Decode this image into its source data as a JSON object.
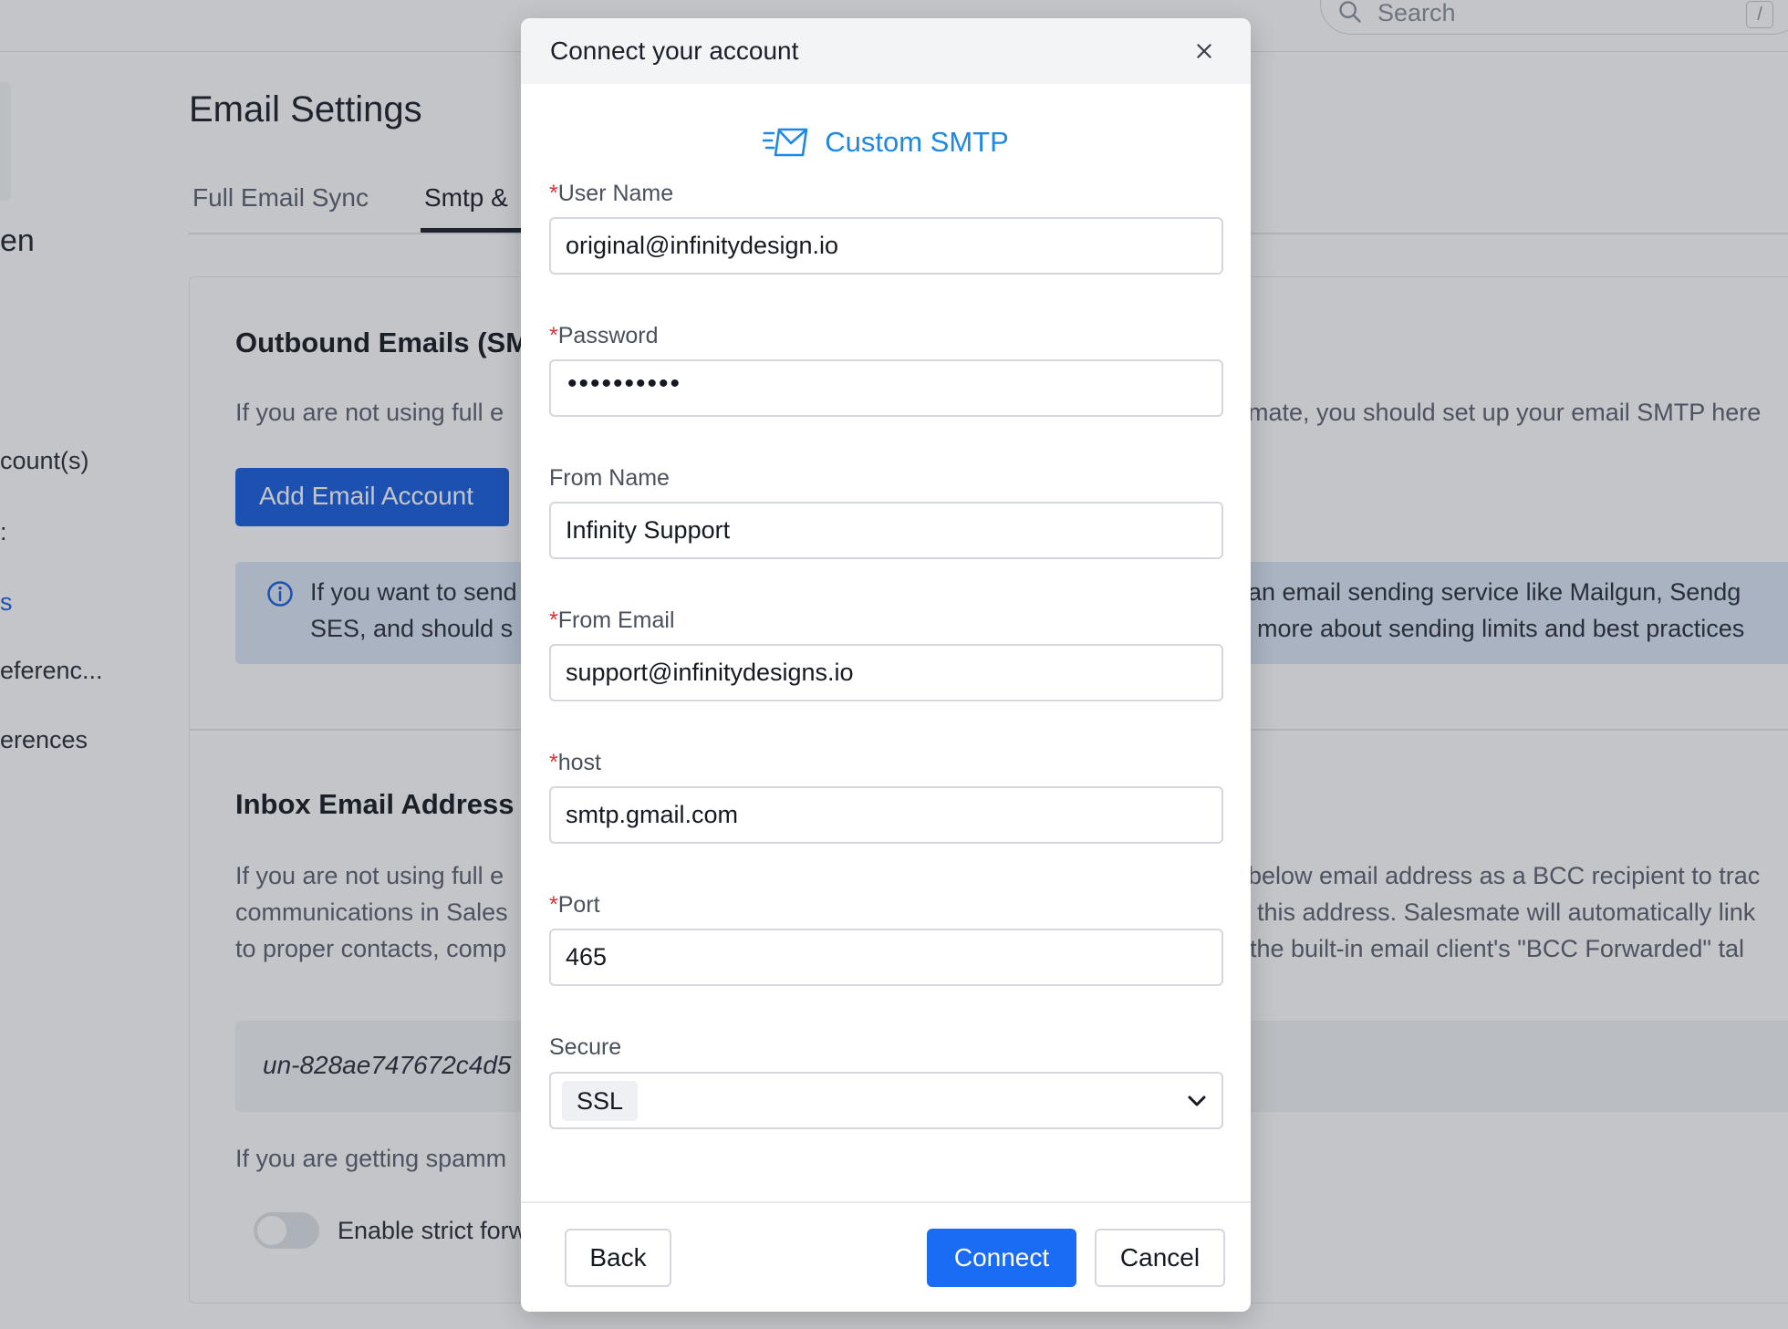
{
  "search": {
    "placeholder": "Search",
    "shortcut": "/"
  },
  "sidebar": {
    "heading": "en",
    "items": [
      {
        "label": "count(s)"
      },
      {
        "label": ":"
      },
      {
        "label": "s"
      },
      {
        "label": "eferenc..."
      },
      {
        "label": "erences"
      }
    ]
  },
  "page": {
    "title": "Email Settings"
  },
  "tabs": [
    {
      "label": "Full Email Sync"
    },
    {
      "label": "Smtp & "
    }
  ],
  "outbound": {
    "title": "Outbound Emails (SM",
    "desc_left": "If you are not using full e",
    "desc_right": "mate, you should set up your email SMTP here",
    "add_button": "Add Email Account",
    "info_line1_left": "If you want to send",
    "info_line1_right": "an email sending service like Mailgun, Sendg",
    "info_line2_left": "SES, and should s",
    "info_line2_right": "more about sending limits and best practices"
  },
  "inbox": {
    "title": "Inbox Email Address",
    "line1_left": "If you are not using full e",
    "line1_right": "below email address as a BCC recipient to trac",
    "line2_left": "communications in Sales",
    "line2_right": "this address. Salesmate will automatically link",
    "line3_left": "to proper contacts, comp",
    "line3_right": "the built-in email client's \"BCC Forwarded\" tal",
    "address": "un-828ae747672c4d5",
    "spam_text": "If you are getting spamm",
    "toggle_label": "Enable strict forw"
  },
  "modal": {
    "title": "Connect your account",
    "provider": "Custom SMTP",
    "fields": {
      "username": {
        "label": "User Name",
        "value": "original@infinitydesign.io",
        "required": true
      },
      "password": {
        "label": "Password",
        "value": "••••••••••",
        "required": true
      },
      "from_name": {
        "label": "From Name",
        "value": "Infinity Support",
        "required": false
      },
      "from_email": {
        "label": "From Email",
        "value": "support@infinitydesigns.io",
        "required": true
      },
      "host": {
        "label": "host",
        "value": "smtp.gmail.com",
        "required": true
      },
      "port": {
        "label": "Port",
        "value": "465",
        "required": true
      },
      "secure": {
        "label": "Secure",
        "value": "SSL"
      }
    },
    "required_mark": "*",
    "buttons": {
      "back": "Back",
      "connect": "Connect",
      "cancel": "Cancel"
    }
  },
  "colors": {
    "primary": "#1a6cf5",
    "provider": "#1e88e5",
    "required": "#e03131",
    "info_bg": "#dbe7f7"
  }
}
